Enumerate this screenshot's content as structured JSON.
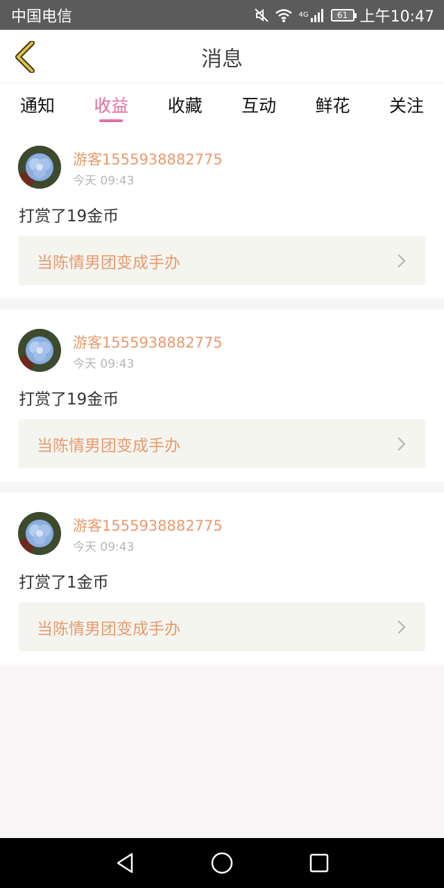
{
  "status_bar": {
    "carrier": "中国电信",
    "battery": "61",
    "network": "4G",
    "time": "上午10:47"
  },
  "header": {
    "title": "消息",
    "back_icon": "chevron-left-icon"
  },
  "tabs": [
    {
      "label": "通知",
      "active": false
    },
    {
      "label": "收益",
      "active": true
    },
    {
      "label": "收藏",
      "active": false
    },
    {
      "label": "互动",
      "active": false
    },
    {
      "label": "鲜花",
      "active": false
    },
    {
      "label": "关注",
      "active": false
    }
  ],
  "messages": [
    {
      "username": "游客1555938882775",
      "time": "今天 09:43",
      "text": "打赏了19金币",
      "link": "当陈情男团变成手办"
    },
    {
      "username": "游客1555938882775",
      "time": "今天 09:43",
      "text": "打赏了19金币",
      "link": "当陈情男团变成手办"
    },
    {
      "username": "游客1555938882775",
      "time": "今天 09:43",
      "text": "打赏了1金币",
      "link": "当陈情男团变成手办"
    }
  ],
  "colors": {
    "accent": "#e46ea0",
    "username": "#e79a6e",
    "status_bar": "#5b5b5b"
  }
}
